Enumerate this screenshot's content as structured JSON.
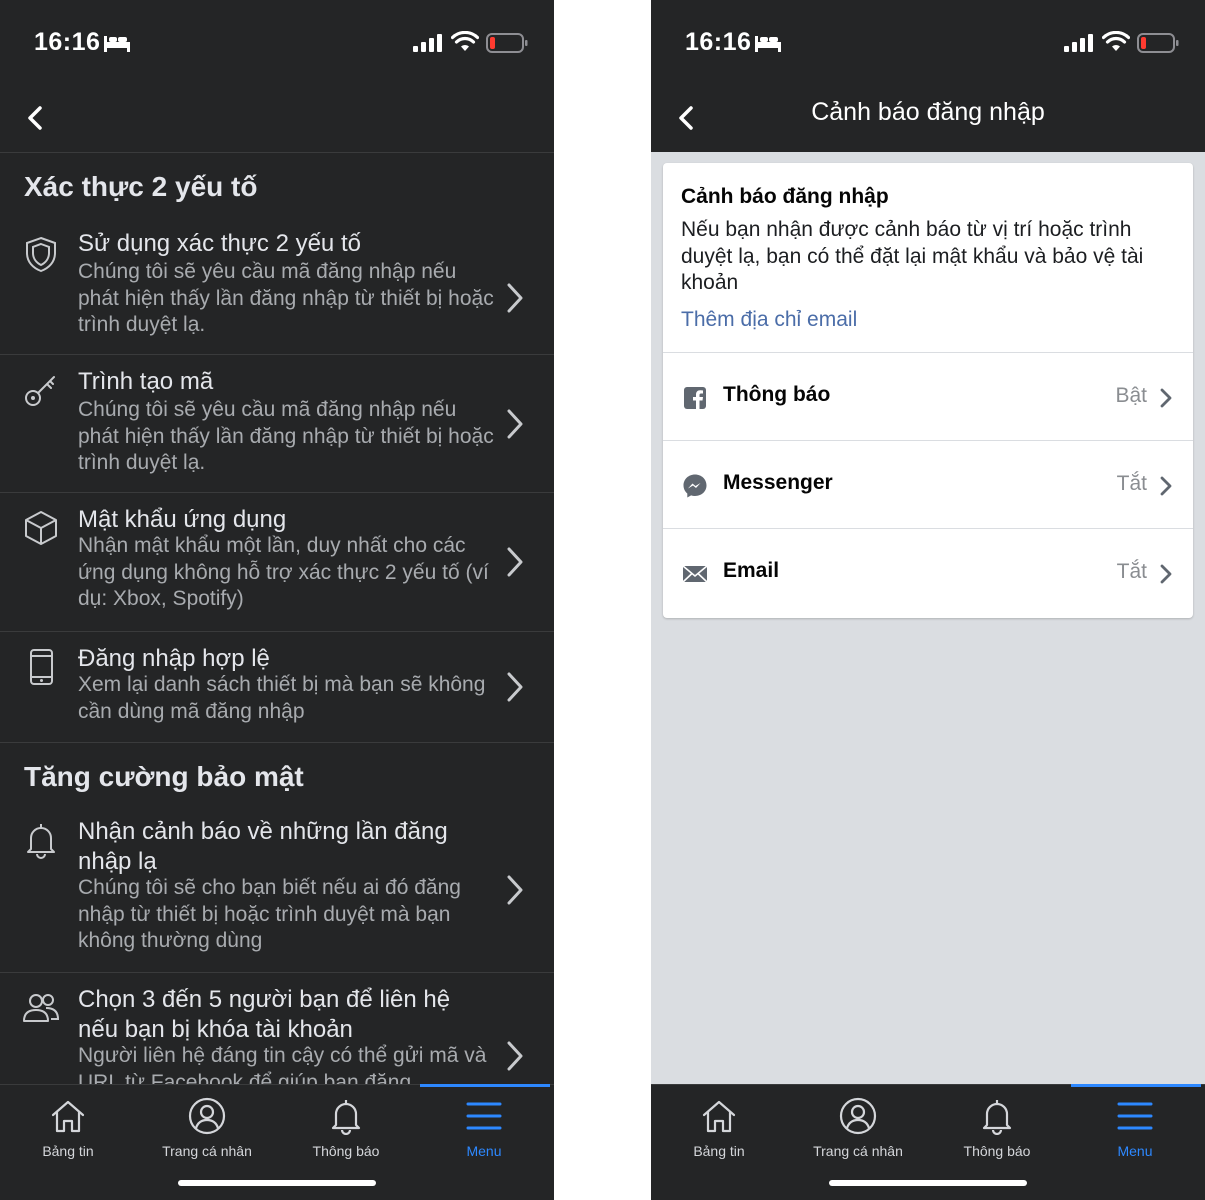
{
  "left": {
    "status": {
      "time": "16:16"
    },
    "sections": [
      {
        "heading": "Xác thực 2 yếu tố",
        "items": [
          {
            "title": "Sử dụng xác thực 2 yếu tố",
            "desc": "Chúng tôi sẽ yêu cầu mã đăng nhập nếu phát hiện thấy lần đăng nhập từ thiết bị hoặc trình duyệt lạ.",
            "icon": "shield-icon"
          },
          {
            "title": "Trình tạo mã",
            "desc": "Chúng tôi sẽ yêu cầu mã đăng nhập nếu phát hiện thấy lần đăng nhập từ thiết bị hoặc trình duyệt lạ.",
            "icon": "key-icon"
          },
          {
            "title": "Mật khẩu ứng dụng",
            "desc": "Nhận mật khẩu một lần, duy nhất cho các ứng dụng không hỗ trợ xác thực 2 yếu tố (ví dụ: Xbox, Spotify)",
            "icon": "cube-icon"
          },
          {
            "title": "Đăng nhập hợp lệ",
            "desc": "Xem lại danh sách thiết bị mà bạn sẽ không cần dùng mã đăng nhập",
            "icon": "phone-icon"
          }
        ]
      },
      {
        "heading": "Tăng cường bảo mật",
        "items": [
          {
            "title": "Nhận cảnh báo về những lần đăng nhập lạ",
            "desc": "Chúng tôi sẽ cho bạn biết nếu ai đó đăng nhập từ thiết bị hoặc trình duyệt mà bạn không thường dùng",
            "icon": "bell-icon"
          },
          {
            "title": "Chọn 3 đến 5 người bạn để liên hệ nếu bạn bị khóa tài khoản",
            "desc": "Người liên hệ đáng tin cậy có thể gửi mã và URL từ Facebook để giúp bạn đăng",
            "icon": "people-icon"
          }
        ]
      }
    ]
  },
  "right": {
    "status": {
      "time": "16:16"
    },
    "nav_title": "Cảnh báo đăng nhập",
    "card": {
      "title": "Cảnh báo đăng nhập",
      "desc": "Nếu bạn nhận được cảnh báo từ vị trí hoặc trình duyệt lạ, bạn có thể đặt lại mật khẩu và bảo vệ tài khoản",
      "link": "Thêm địa chỉ email"
    },
    "rows": [
      {
        "label": "Thông báo",
        "value": "Bật",
        "icon": "facebook-icon"
      },
      {
        "label": "Messenger",
        "value": "Tắt",
        "icon": "messenger-icon"
      },
      {
        "label": "Email",
        "value": "Tắt",
        "icon": "envelope-icon"
      }
    ]
  },
  "tabs": [
    {
      "label": "Bảng tin",
      "icon": "home-icon"
    },
    {
      "label": "Trang cá nhân",
      "icon": "profile-icon"
    },
    {
      "label": "Thông báo",
      "icon": "bell-icon"
    },
    {
      "label": "Menu",
      "icon": "menu-icon",
      "active": true
    }
  ],
  "colors": {
    "accent": "#2d88ff",
    "dark_bg": "#242526",
    "link": "#4b6da8"
  }
}
